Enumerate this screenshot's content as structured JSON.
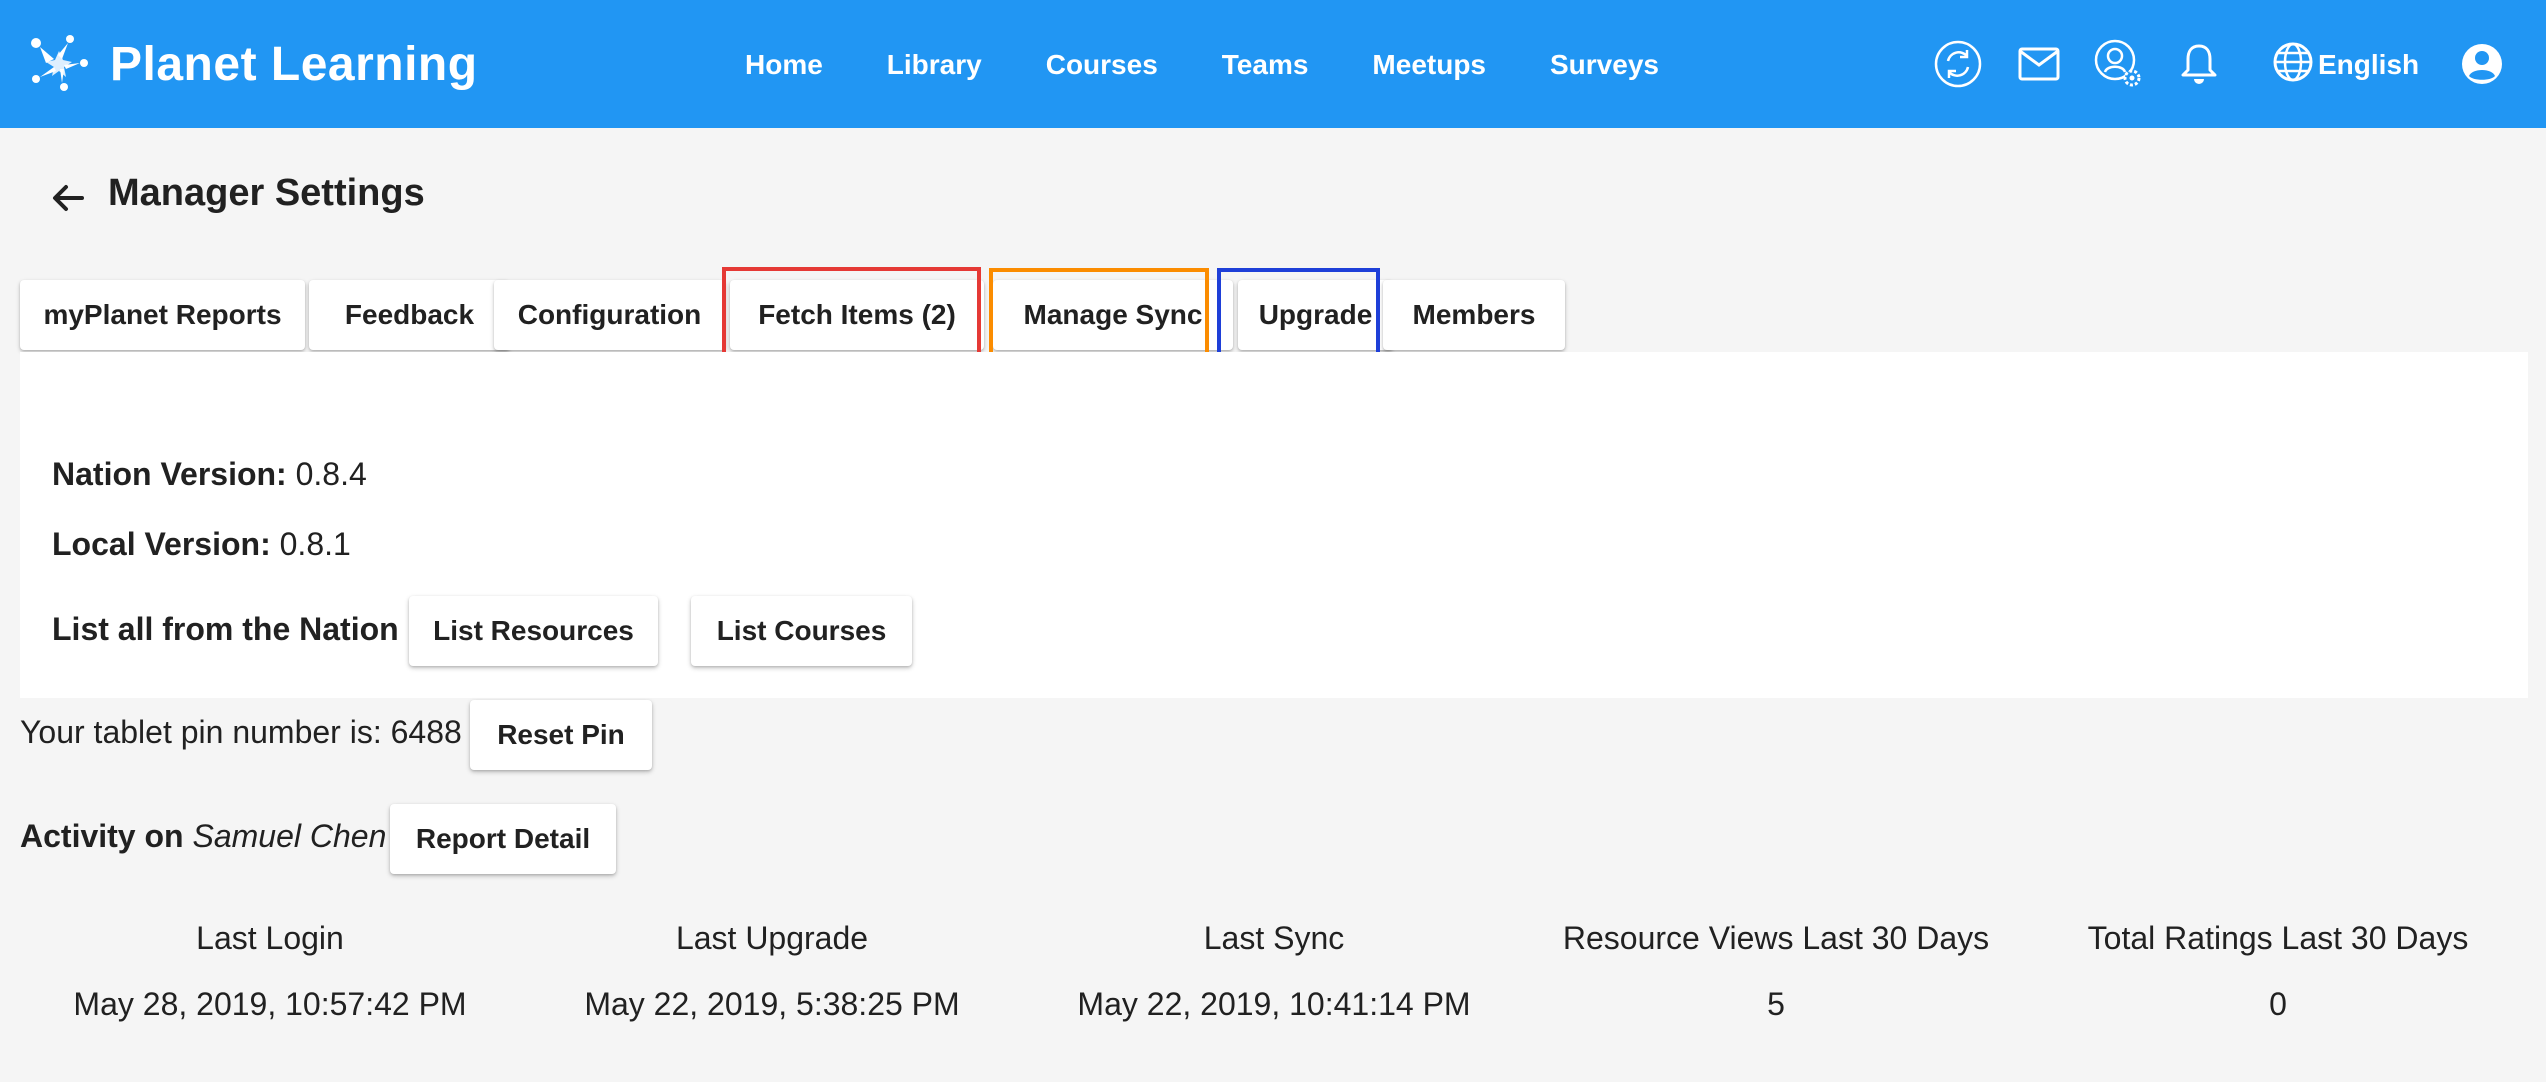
{
  "app": {
    "title": "Planet Learning"
  },
  "nav": {
    "items": [
      "Home",
      "Library",
      "Courses",
      "Teams",
      "Meetups",
      "Surveys"
    ]
  },
  "header_actions": {
    "language": "English",
    "icons": [
      "sync-icon",
      "mail-icon",
      "user-settings-icon",
      "bell-icon",
      "globe-icon",
      "account-circle-icon"
    ]
  },
  "page": {
    "title": "Manager Settings"
  },
  "tabs": {
    "items": [
      "myPlanet Reports",
      "Feedback",
      "Configuration",
      "Fetch Items (2)",
      "Manage Sync",
      "Upgrade",
      "Members"
    ],
    "highlight_colors": {
      "fetch_items": "#e53935",
      "manage_sync": "#fb8c00",
      "upgrade": "#1e3fd8"
    }
  },
  "versions": {
    "nation_label": "Nation Version:",
    "nation_value": " 0.8.4",
    "local_label": "Local Version:",
    "local_value": " 0.8.1",
    "list_label": "List all from the Nation",
    "list_resources_button": "List Resources",
    "list_courses_button": "List Courses"
  },
  "pin": {
    "text": "Your tablet pin number is: 6488",
    "reset_button": "Reset Pin"
  },
  "activity": {
    "label": "Activity on ",
    "user": "Samuel Chen",
    "report_button": "Report Detail"
  },
  "stats": [
    {
      "label": "Last Login",
      "value": "May 28, 2019, 10:57:42 PM"
    },
    {
      "label": "Last Upgrade",
      "value": "May 22, 2019, 5:38:25 PM"
    },
    {
      "label": "Last Sync",
      "value": "May 22, 2019, 10:41:14 PM"
    },
    {
      "label": "Resource Views Last 30 Days",
      "value": "5"
    },
    {
      "label": "Total Ratings Last 30 Days",
      "value": "0"
    }
  ],
  "colors": {
    "primary": "#2196f3",
    "background": "#f5f5f5"
  }
}
